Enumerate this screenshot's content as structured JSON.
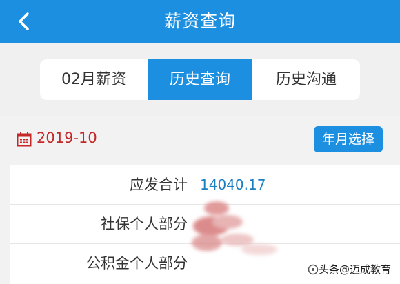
{
  "header": {
    "title": "薪资查询",
    "back_icon": "chevron-left-icon"
  },
  "tabs": [
    {
      "label": "02月薪资",
      "active": false
    },
    {
      "label": "历史查询",
      "active": true
    },
    {
      "label": "历史沟通",
      "active": false
    }
  ],
  "date_bar": {
    "icon": "calendar-icon",
    "date": "2019-10",
    "select_button": "年月选择"
  },
  "salary_rows": [
    {
      "label": "应发合计",
      "value": "14040.17"
    },
    {
      "label": "社保个人部分",
      "value": ""
    },
    {
      "label": "公积金个人部分",
      "value": ""
    }
  ],
  "watermark": "头条@迈成教育",
  "colors": {
    "primary": "#1d8fe0",
    "date_red": "#c62828",
    "value_blue": "#1a7fc1"
  }
}
